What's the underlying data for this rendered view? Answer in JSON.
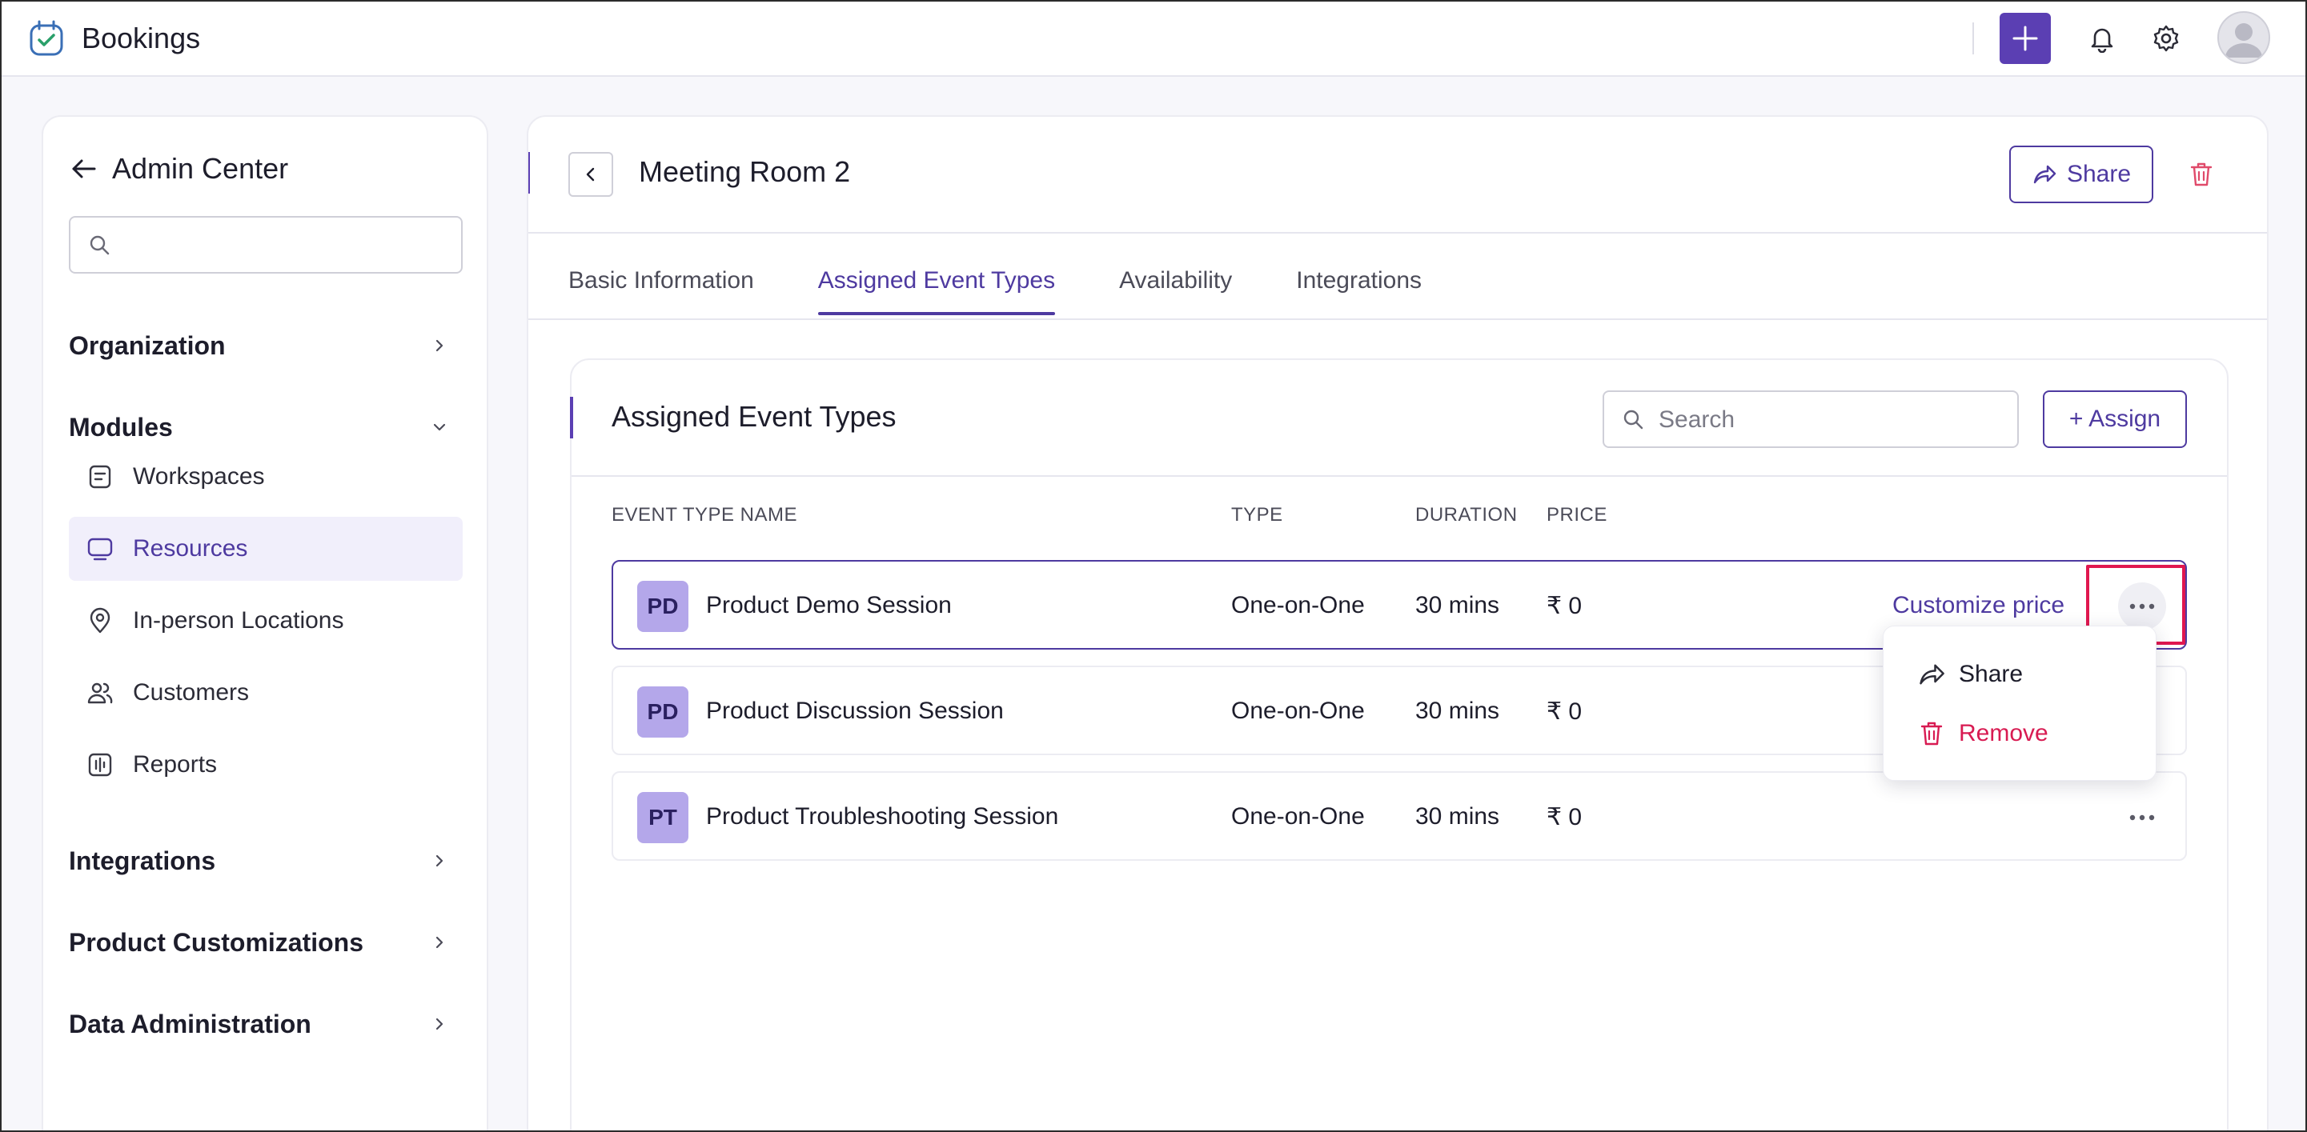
{
  "app": {
    "title": "Bookings"
  },
  "sidebar": {
    "header": "Admin Center",
    "search_placeholder": "",
    "sections": [
      {
        "label": "Organization",
        "expanded": false
      },
      {
        "label": "Modules",
        "expanded": true
      },
      {
        "label": "Integrations",
        "expanded": false
      },
      {
        "label": "Product Customizations",
        "expanded": false
      },
      {
        "label": "Data Administration",
        "expanded": false
      }
    ],
    "module_items": [
      {
        "label": "Workspaces",
        "icon": "workspace-icon",
        "active": false
      },
      {
        "label": "Resources",
        "icon": "monitor-icon",
        "active": true
      },
      {
        "label": "In-person Locations",
        "icon": "location-pin-icon",
        "active": false
      },
      {
        "label": "Customers",
        "icon": "users-icon",
        "active": false
      },
      {
        "label": "Reports",
        "icon": "reports-icon",
        "active": false
      }
    ]
  },
  "page": {
    "title": "Meeting Room 2",
    "share_label": "Share",
    "tabs": [
      {
        "label": "Basic Information",
        "active": false
      },
      {
        "label": "Assigned Event Types",
        "active": true
      },
      {
        "label": "Availability",
        "active": false
      },
      {
        "label": "Integrations",
        "active": false
      }
    ]
  },
  "card": {
    "title": "Assigned Event Types",
    "search_placeholder": "Search",
    "assign_label": "+ Assign",
    "columns": [
      "EVENT TYPE NAME",
      "TYPE",
      "DURATION",
      "PRICE"
    ],
    "rows": [
      {
        "initials": "PD",
        "name": "Product Demo Session",
        "type": "One-on-One",
        "duration": "30 mins",
        "price": "₹ 0",
        "action": "Customize price"
      },
      {
        "initials": "PD",
        "name": "Product Discussion Session",
        "type": "One-on-One",
        "duration": "30 mins",
        "price": "₹ 0"
      },
      {
        "initials": "PT",
        "name": "Product Troubleshooting Session",
        "type": "One-on-One",
        "duration": "30 mins",
        "price": "₹ 0"
      }
    ]
  },
  "row_menu": {
    "share_label": "Share",
    "remove_label": "Remove"
  },
  "colors": {
    "accent": "#5b3fb3",
    "link": "#4e3aa0",
    "danger": "#d81b52",
    "badge": "#b4a7ea",
    "highlight": "#e0174f"
  }
}
